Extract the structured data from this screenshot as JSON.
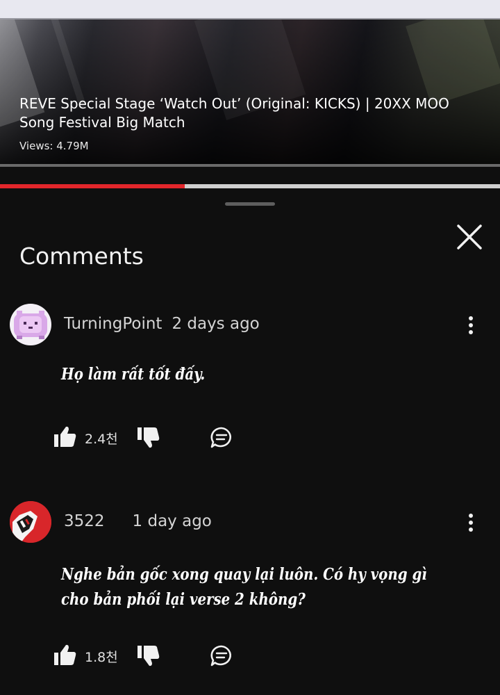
{
  "video": {
    "title": "REVE Special Stage ‘Watch Out’ (Original: KICKS) | 20XX MOO Song Festival Big Match",
    "views": "Views: 4.79M",
    "progress": 0.37
  },
  "comments_panel": {
    "title": "Comments",
    "close_icon": "close-icon"
  },
  "comments": [
    {
      "author": "TurningPoint",
      "time": "2 days ago",
      "text": "Họ làm rất tốt đấy.",
      "likes": "2.4천",
      "avatar": "pink-pixel-cat-avatar"
    },
    {
      "author": "3522",
      "time": "1 day ago",
      "text": "Nghe bản gốc xong quay lại luôn. Có hy vọng gì cho bản phối lại verse 2 không?",
      "likes": "1.8천",
      "avatar": "red-mascot-avatar"
    }
  ],
  "colors": {
    "background": "#0f0f0f",
    "progress": "#e2262b",
    "text": "#f1f1f1"
  }
}
